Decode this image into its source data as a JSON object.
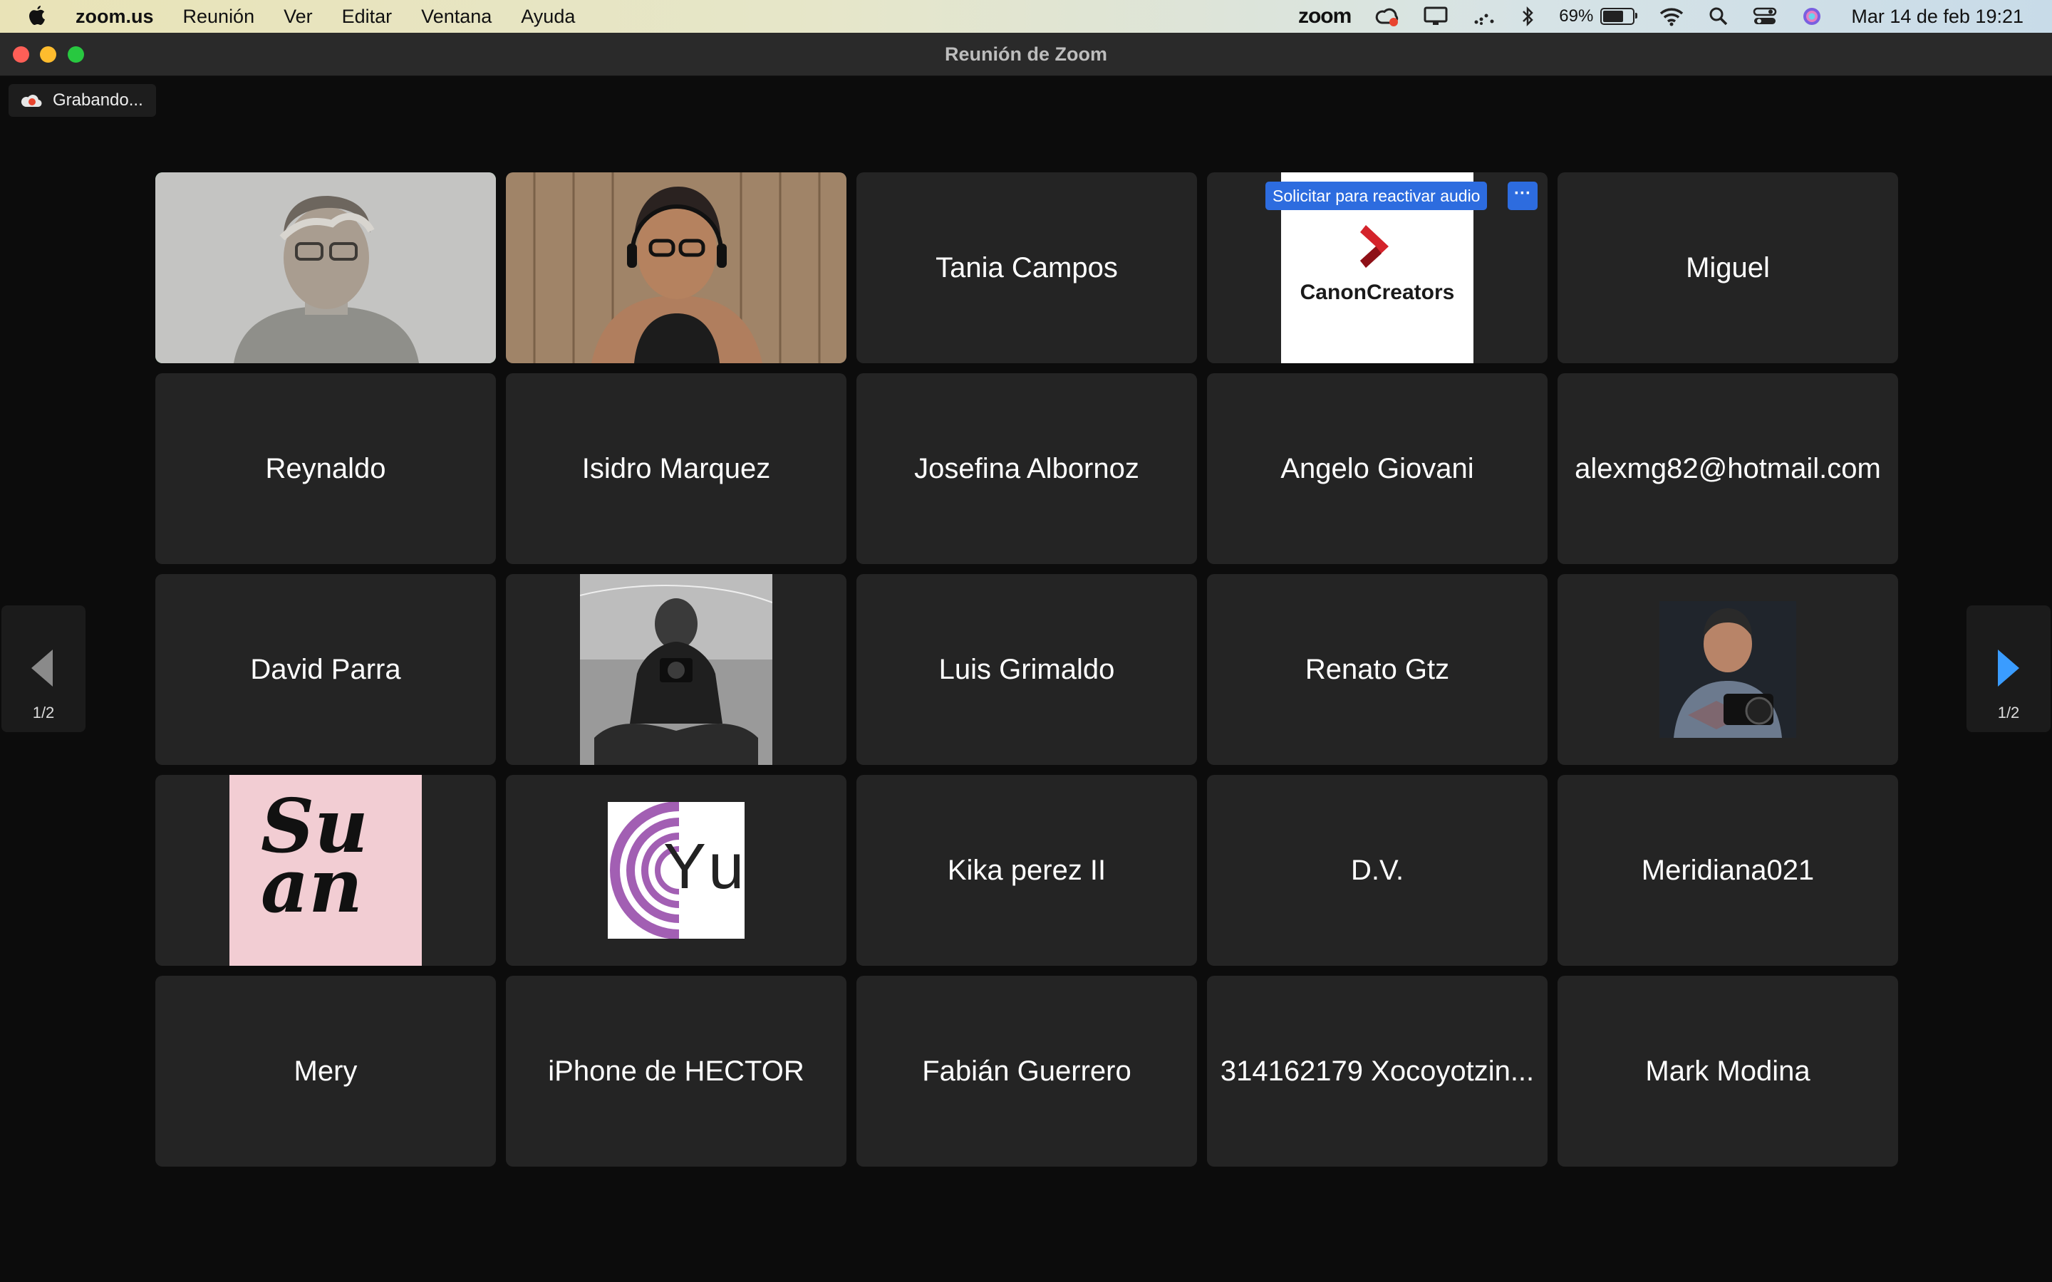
{
  "menubar": {
    "app": "zoom.us",
    "items": [
      "Reunión",
      "Ver",
      "Editar",
      "Ventana",
      "Ayuda"
    ],
    "zoom_label": "zoom",
    "battery": "69%",
    "battery_level": 0.69,
    "clock": "Mar 14 de feb  19:21"
  },
  "window": {
    "title": "Reunión de Zoom"
  },
  "recording": {
    "label": "Grabando..."
  },
  "unmute": {
    "label": "Solicitar para reactivar audio",
    "more": "···"
  },
  "pager": {
    "left": "1/2",
    "right": "1/2"
  },
  "tiles": [
    {
      "type": "video",
      "name": "participant-video-1"
    },
    {
      "type": "video",
      "name": "participant-video-2"
    },
    {
      "type": "name",
      "label": "Tania Campos"
    },
    {
      "type": "logo",
      "label": "CanonCreators"
    },
    {
      "type": "name",
      "label": "Miguel"
    },
    {
      "type": "name",
      "label": "Reynaldo"
    },
    {
      "type": "name",
      "label": "Isidro Marquez"
    },
    {
      "type": "name",
      "label": "Josefina Albornoz"
    },
    {
      "type": "name",
      "label": "Angelo Giovani"
    },
    {
      "type": "name",
      "label": "alexmg82@hotmail.com"
    },
    {
      "type": "name",
      "label": "David Parra"
    },
    {
      "type": "photo",
      "name": "profile-photo-bw"
    },
    {
      "type": "name",
      "label": "Luis Grimaldo"
    },
    {
      "type": "name",
      "label": "Renato Gtz"
    },
    {
      "type": "photo",
      "name": "profile-photo-camera"
    },
    {
      "type": "logo",
      "label": "Su an"
    },
    {
      "type": "logo",
      "label": "Yu"
    },
    {
      "type": "name",
      "label": "Kika perez II"
    },
    {
      "type": "name",
      "label": "D.V."
    },
    {
      "type": "name",
      "label": "Meridiana021"
    },
    {
      "type": "name",
      "label": "Mery"
    },
    {
      "type": "name",
      "label": "iPhone de HECTOR"
    },
    {
      "type": "name",
      "label": "Fabián Guerrero"
    },
    {
      "type": "name",
      "label": "314162179 Xocoyotzin..."
    },
    {
      "type": "name",
      "label": "Mark Modina"
    }
  ],
  "colors": {
    "active_border": "#23d160",
    "tile_bg": "#242424",
    "accent_blue": "#2d6cdf"
  }
}
